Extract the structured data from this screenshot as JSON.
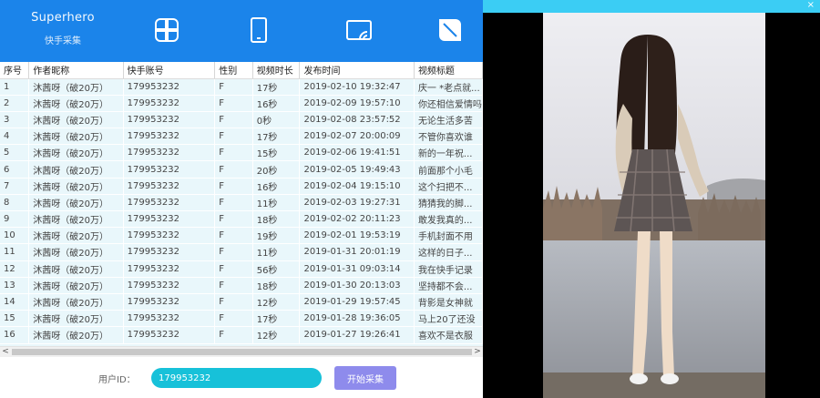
{
  "app": {
    "title": "Superhero",
    "subtitle": "快手采集"
  },
  "nav": [
    {
      "name": "clover-icon"
    },
    {
      "name": "phone-icon"
    },
    {
      "name": "screen-icon"
    },
    {
      "name": "leaf-icon"
    }
  ],
  "table": {
    "headers": [
      "序号",
      "作者昵称",
      "快手账号",
      "性别",
      "视频时长",
      "发布时间",
      "视频标题"
    ],
    "rows": [
      [
        "1",
        "沐茜呀（破20万）",
        "179953232",
        "F",
        "17秒",
        "2019-02-10 19:32:47",
        "庆一 *老点就..."
      ],
      [
        "2",
        "沐茜呀（破20万）",
        "179953232",
        "F",
        "16秒",
        "2019-02-09 19:57:10",
        "你还相信爱情吗"
      ],
      [
        "3",
        "沐茜呀（破20万）",
        "179953232",
        "F",
        "0秒",
        "2019-02-08 23:57:52",
        "无论生活多苦"
      ],
      [
        "4",
        "沐茜呀（破20万）",
        "179953232",
        "F",
        "17秒",
        "2019-02-07 20:00:09",
        "不管你喜欢谁"
      ],
      [
        "5",
        "沐茜呀（破20万）",
        "179953232",
        "F",
        "15秒",
        "2019-02-06 19:41:51",
        "新的一年祝..."
      ],
      [
        "6",
        "沐茜呀（破20万）",
        "179953232",
        "F",
        "20秒",
        "2019-02-05 19:49:43",
        "前面那个小毛"
      ],
      [
        "7",
        "沐茜呀（破20万）",
        "179953232",
        "F",
        "16秒",
        "2019-02-04 19:15:10",
        "这个扫把不..."
      ],
      [
        "8",
        "沐茜呀（破20万）",
        "179953232",
        "F",
        "11秒",
        "2019-02-03 19:27:31",
        "猜猜我的脚..."
      ],
      [
        "9",
        "沐茜呀（破20万）",
        "179953232",
        "F",
        "18秒",
        "2019-02-02 20:11:23",
        "敢发我真的..."
      ],
      [
        "10",
        "沐茜呀（破20万）",
        "179953232",
        "F",
        "19秒",
        "2019-02-01 19:53:19",
        "手机封面不用"
      ],
      [
        "11",
        "沐茜呀（破20万）",
        "179953232",
        "F",
        "11秒",
        "2019-01-31 20:01:19",
        "这样的日子..."
      ],
      [
        "12",
        "沐茜呀（破20万）",
        "179953232",
        "F",
        "56秒",
        "2019-01-31 09:03:14",
        "我在快手记录"
      ],
      [
        "13",
        "沐茜呀（破20万）",
        "179953232",
        "F",
        "18秒",
        "2019-01-30 20:13:03",
        "坚持都不会..."
      ],
      [
        "14",
        "沐茜呀（破20万）",
        "179953232",
        "F",
        "12秒",
        "2019-01-29 19:57:45",
        "背影是女神就"
      ],
      [
        "15",
        "沐茜呀（破20万）",
        "179953232",
        "F",
        "17秒",
        "2019-01-28 19:36:05",
        "马上20了还没"
      ],
      [
        "16",
        "沐茜呀（破20万）",
        "179953232",
        "F",
        "12秒",
        "2019-01-27 19:26:41",
        "喜欢不是衣服"
      ]
    ]
  },
  "scroll": {
    "left": "<",
    "right": ">"
  },
  "form": {
    "uid_label": "用户ID：",
    "uid_value": "179953232",
    "start_label": "开始采集"
  },
  "viewer": {
    "close": "×"
  },
  "colors": {
    "header": "#1b84ea",
    "rows": "#e9f7fb",
    "input": "#17c1d9",
    "button": "#8e8bec",
    "viewer_bar": "#3bcdf4"
  }
}
